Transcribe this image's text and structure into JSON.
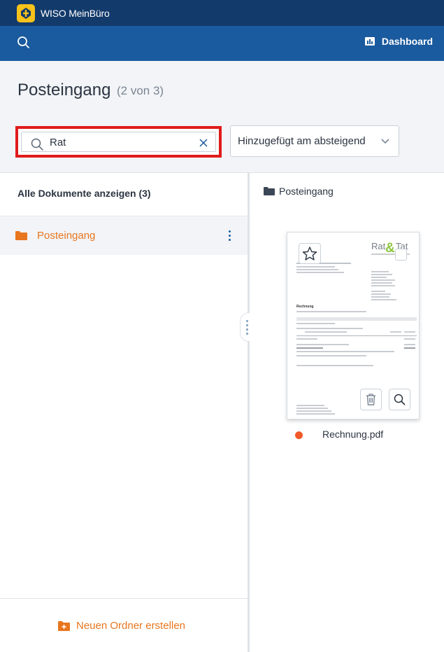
{
  "app": {
    "title": "WISO MeinBüro",
    "brand_color": "#123a6b",
    "nav_color": "#1a5a9e",
    "accent_color": "#e8761f"
  },
  "navbar": {
    "search_icon": "search-icon",
    "dashboard_label": "Dashboard",
    "dashboard_icon": "chart-icon"
  },
  "header": {
    "title": "Posteingang",
    "count": "(2 von 3)"
  },
  "search": {
    "value": "Rat",
    "placeholder": ""
  },
  "sort": {
    "selected": "Hinzugefügt am absteigend"
  },
  "sidebar": {
    "all_documents_label": "Alle Dokumente anzeigen (3)",
    "folders": [
      {
        "label": "Posteingang",
        "icon": "folder-icon",
        "selected": true
      }
    ],
    "new_folder_label": "Neuen Ordner erstellen"
  },
  "content": {
    "breadcrumb": "Posteingang",
    "documents": [
      {
        "filename": "Rechnung.pdf",
        "status_color": "#f05a28",
        "preview": {
          "logo_left": "Rat",
          "logo_amp": "&",
          "logo_right": "Tat",
          "heading": "Rechnung"
        }
      }
    ]
  }
}
